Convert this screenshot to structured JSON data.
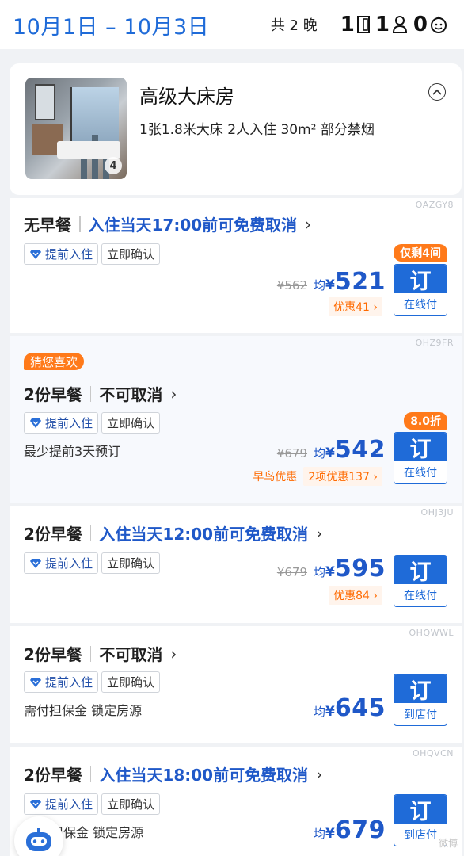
{
  "header": {
    "dates": "10月1日 – 10月3日",
    "nights": "共 2 晚",
    "rooms": "1",
    "adults": "1",
    "children": "0"
  },
  "room": {
    "title": "高级大床房",
    "meta": "1张1.8米大床  2人入住  30m²  部分禁烟",
    "image_count": "4"
  },
  "plans": [
    {
      "code": "OAZGY8",
      "meal": "无早餐",
      "policy": "入住当天17:00前可免费取消",
      "tag_early": "提前入住",
      "tag_confirm": "立即确认",
      "badge": "仅剩4间",
      "orig": "¥562",
      "avg": "均",
      "yen": "¥",
      "amount": "521",
      "promo": "优惠41 ›",
      "book": "订",
      "pay": "在线付"
    },
    {
      "code": "OHZ9FR",
      "guess": "猜您喜欢",
      "meal": "2份早餐",
      "policy": "不可取消",
      "tag_early": "提前入住",
      "tag_confirm": "立即确认",
      "note": "最少提前3天预订",
      "badge": "8.0折",
      "orig": "¥679",
      "avg": "均",
      "yen": "¥",
      "amount": "542",
      "promo_early": "早鸟优惠",
      "promo": "2项优惠137 ›",
      "book": "订",
      "pay": "在线付"
    },
    {
      "code": "OHJ3JU",
      "meal": "2份早餐",
      "policy": "入住当天12:00前可免费取消",
      "tag_early": "提前入住",
      "tag_confirm": "立即确认",
      "orig": "¥679",
      "avg": "均",
      "yen": "¥",
      "amount": "595",
      "promo": "优惠84 ›",
      "book": "订",
      "pay": "在线付"
    },
    {
      "code": "OHQWWL",
      "meal": "2份早餐",
      "policy": "不可取消",
      "tag_early": "提前入住",
      "tag_confirm": "立即确认",
      "note": "需付担保金 锁定房源",
      "avg": "均",
      "yen": "¥",
      "amount": "645",
      "book": "订",
      "pay": "到店付"
    },
    {
      "code": "OHQVCN",
      "meal": "2份早餐",
      "policy": "入住当天18:00前可免费取消",
      "tag_early": "提前入住",
      "tag_confirm": "立即确认",
      "note": "担保金 锁定房源",
      "avg": "均",
      "yen": "¥",
      "amount": "679",
      "book": "订",
      "pay": "到店付"
    }
  ],
  "chevron": "›",
  "watermark": "微博"
}
